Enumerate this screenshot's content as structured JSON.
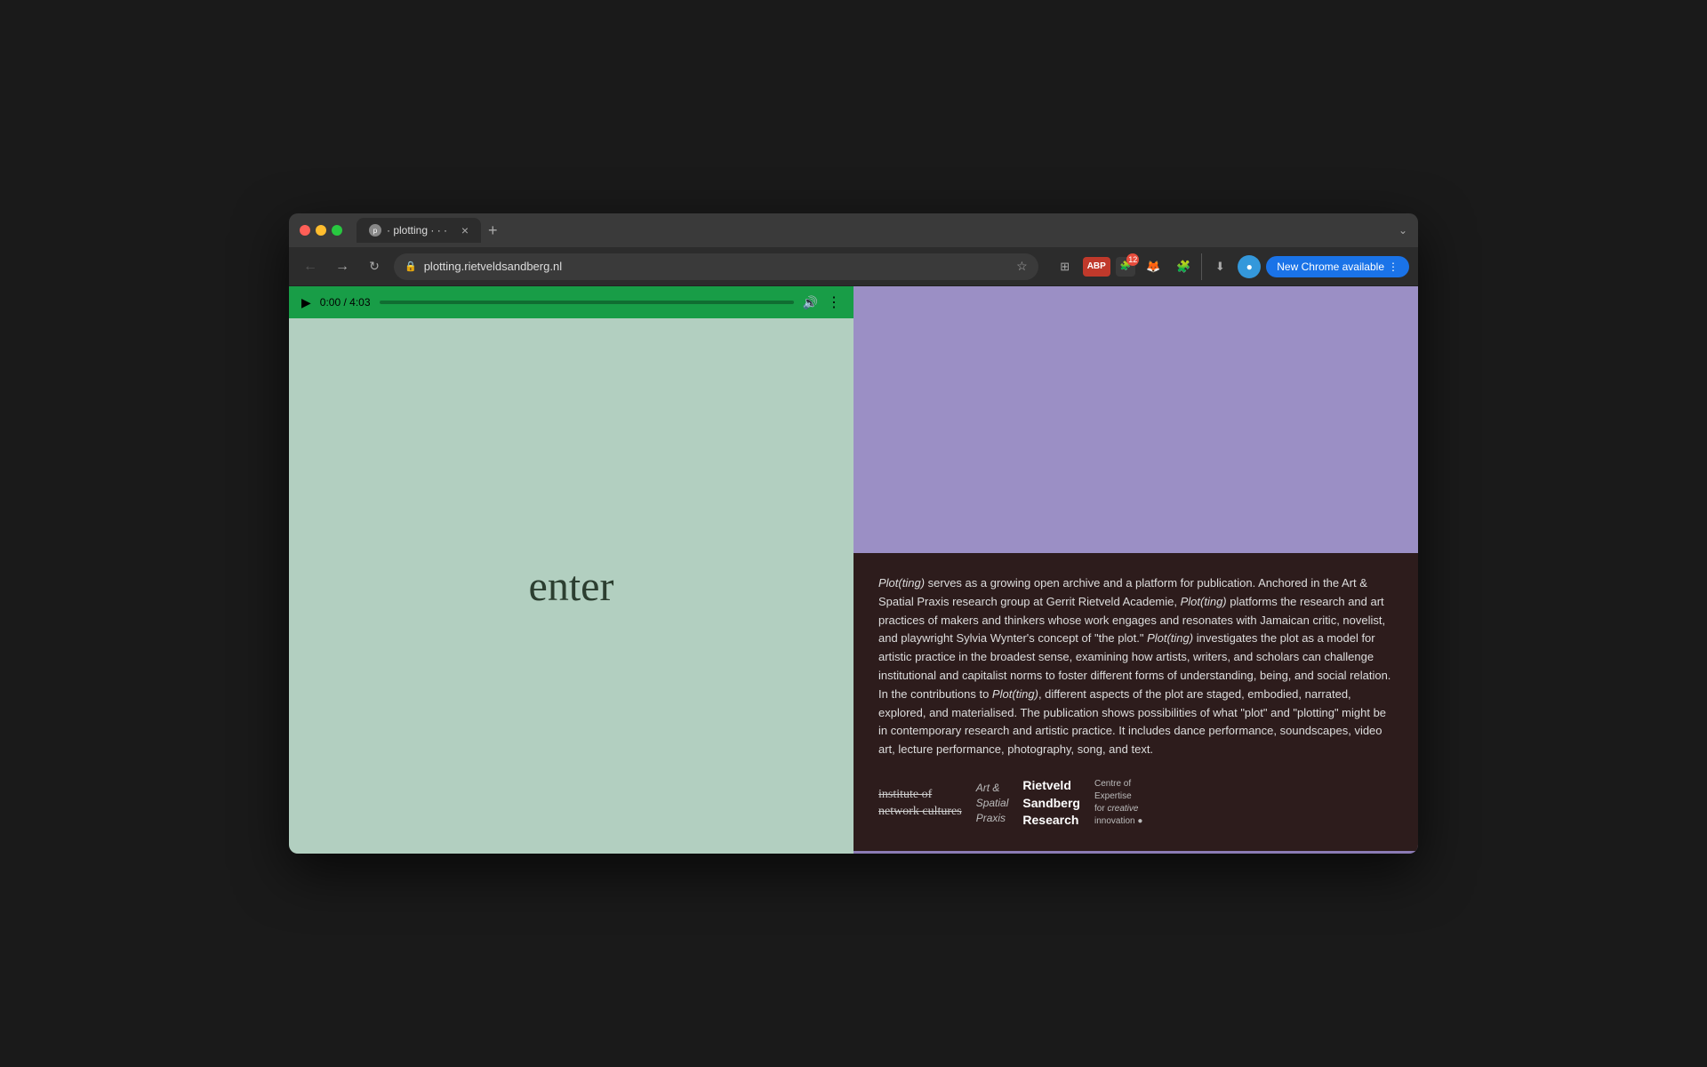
{
  "browser": {
    "window_controls": {
      "close_label": "close",
      "min_label": "minimize",
      "max_label": "maximize"
    },
    "tab": {
      "title": "· plotting · · ·",
      "favicon_label": "plotting"
    },
    "tab_new_label": "+",
    "tab_list_label": "⌄",
    "address": {
      "url": "plotting.rietveldsandberg.nl",
      "lock_icon": "🔒"
    },
    "actions": {
      "back_label": "←",
      "forward_label": "→",
      "reload_label": "↻",
      "star_label": "☆",
      "extensions_label": "🧩",
      "download_label": "⬇",
      "profile_label": "●",
      "new_chrome_label": "New Chrome available",
      "menu_label": "⋮",
      "abp_label": "ABP",
      "badge_count": "12"
    }
  },
  "web_content": {
    "video": {
      "current_time": "0:00",
      "total_time": "4:03",
      "play_label": "▶",
      "volume_label": "🔊",
      "more_label": "⋮"
    },
    "enter_label": "enter",
    "description": {
      "text_parts": [
        "Plot(ting) serves as a growing open archive and a platform for publication. Anchored in the Art & Spatial Praxis research group at Gerrit Rietveld Academie, ",
        "Plot(ting)",
        " platforms the research and art practices of makers and thinkers whose work engages and resonates with Jamaican critic, novelist, and playwright Sylvia Wynter's concept of \"the plot.\" ",
        "Plot(ting)",
        " investigates the plot as a model for artistic practice in the broadest sense, examining how artists, writers, and scholars can challenge institutional and capitalist norms to foster different forms of understanding, being, and social relation. In the contributions to ",
        "Plot(ting)",
        ", different aspects of the plot are staged, embodied, narrated, explored, and materialised. The publication shows possibilities of what \"plot\" and \"plotting\" might be in contemporary research and artistic practice. It includes dance performance, soundscapes, video art, lecture performance, photography, song, and text."
      ]
    },
    "logos": [
      {
        "line1": "institute of",
        "line2": "network cultures",
        "style": "serif"
      },
      {
        "line1": "Art &",
        "line2": "Spatial",
        "line3": "Praxis",
        "style": "script"
      },
      {
        "line1": "Rietveld",
        "line2": "Sandberg",
        "line3": "Research",
        "style": "bold"
      },
      {
        "line1": "Centre of",
        "line2": "Expertise",
        "line3": "for creative",
        "line4": "innovation",
        "style": "small"
      }
    ]
  }
}
